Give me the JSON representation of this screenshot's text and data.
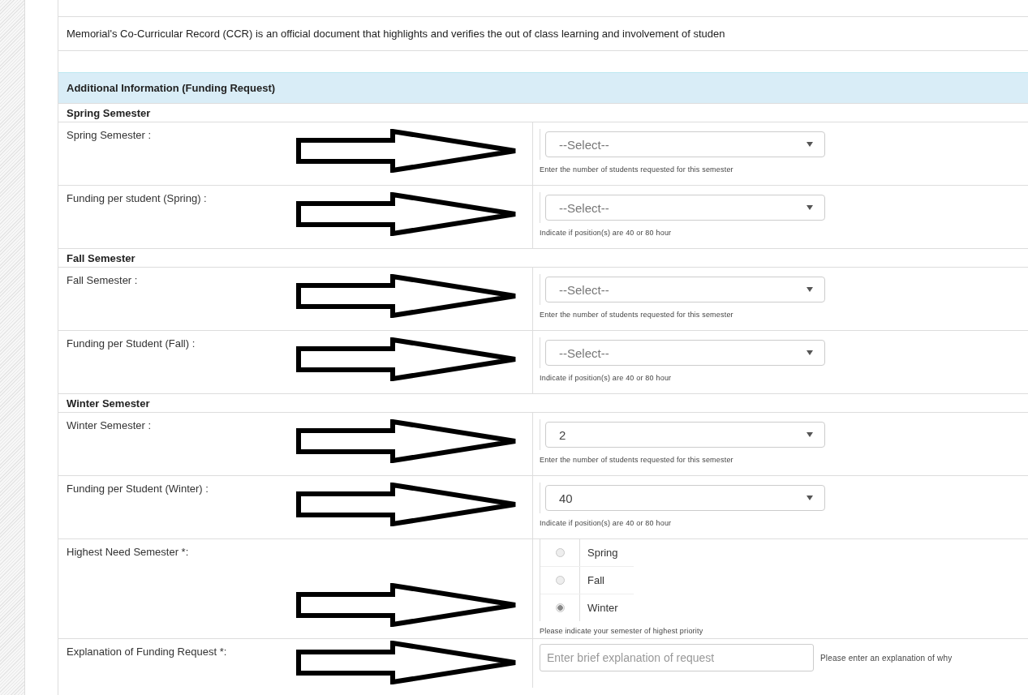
{
  "intro": "Memorial's Co-Curricular Record (CCR) is an official document that highlights and verifies the out of class learning and involvement of studen",
  "panel": {
    "title": "Additional Information (Funding Request)",
    "rows": [
      {
        "kind": "section",
        "label": "Spring Semester"
      },
      {
        "kind": "select",
        "label": "Spring Semester :",
        "value": "--Select--",
        "chosen": false,
        "help": "Enter the number of students requested for this semester",
        "marked": true
      },
      {
        "kind": "select",
        "label": "Funding per student (Spring) :",
        "value": "--Select--",
        "chosen": false,
        "help": "Indicate if position(s) are 40 or 80 hour",
        "marked": true
      },
      {
        "kind": "section",
        "label": "Fall Semester"
      },
      {
        "kind": "select",
        "label": "Fall Semester :",
        "value": "--Select--",
        "chosen": false,
        "help": "Enter the number of students requested for this semester",
        "marked": true
      },
      {
        "kind": "select",
        "label": "Funding per Student (Fall) :",
        "value": "--Select--",
        "chosen": false,
        "help": "Indicate if position(s) are 40 or 80 hour",
        "marked": true
      },
      {
        "kind": "section",
        "label": "Winter Semester"
      },
      {
        "kind": "select",
        "label": "Winter Semester :",
        "value": "2",
        "chosen": true,
        "help": "Enter the number of students requested for this semester",
        "marked": true
      },
      {
        "kind": "select",
        "label": "Funding per Student (Winter) :",
        "value": "40",
        "chosen": true,
        "help": "Indicate if position(s) are 40 or 80 hour",
        "marked": true
      },
      {
        "kind": "radio",
        "label": "Highest Need Semester *:",
        "options": [
          {
            "label": "Spring",
            "selected": false
          },
          {
            "label": "Fall",
            "selected": false
          },
          {
            "label": "Winter",
            "selected": true
          }
        ],
        "help": "Please indicate your semester of highest priority",
        "marked": true
      },
      {
        "kind": "text",
        "label": "Explanation of Funding Request *:",
        "placeholder": "Enter brief explanation of request",
        "help": "Please enter an explanation of why",
        "marked": true
      }
    ]
  }
}
